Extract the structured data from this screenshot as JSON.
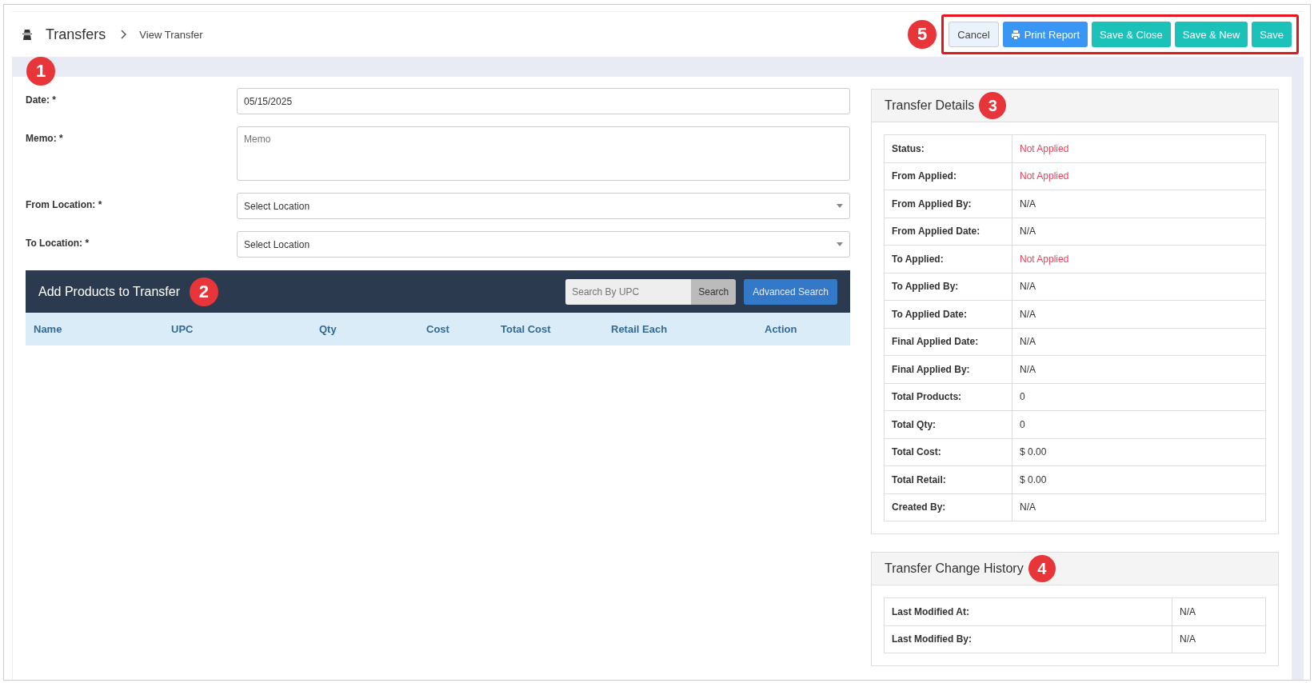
{
  "header": {
    "title": "Transfers",
    "breadcrumb": "View Transfer",
    "callout": "5",
    "buttons": [
      {
        "label": "Cancel",
        "kind": "cancel"
      },
      {
        "label": "Print Report",
        "kind": "print"
      },
      {
        "label": "Save & Close",
        "kind": "save"
      },
      {
        "label": "Save & New",
        "kind": "save"
      },
      {
        "label": "Save",
        "kind": "save"
      }
    ]
  },
  "form": {
    "callout": "1",
    "fields": [
      {
        "label": "Date: *",
        "kind": "text",
        "value": "05/15/2025"
      },
      {
        "label": "Memo: *",
        "kind": "textarea",
        "placeholder": "Memo"
      },
      {
        "label": "From Location: *",
        "kind": "select",
        "value": "Select Location"
      },
      {
        "label": "To Location: *",
        "kind": "select",
        "value": "Select Location"
      }
    ]
  },
  "products": {
    "title": "Add Products to Transfer",
    "callout": "2",
    "search": {
      "placeholder": "Search By UPC",
      "button": "Search"
    },
    "advanced_button": "Advanced Search",
    "columns": [
      "Name",
      "UPC",
      "Qty",
      "Cost",
      "Total Cost",
      "Retail Each",
      "Action"
    ]
  },
  "details": {
    "title": "Transfer Details",
    "callout": "3",
    "rows": [
      {
        "label": "Status:",
        "value": "Not Applied",
        "alert": true
      },
      {
        "label": "From Applied:",
        "value": "Not Applied",
        "alert": true
      },
      {
        "label": "From Applied By:",
        "value": "N/A",
        "alert": false
      },
      {
        "label": "From Applied Date:",
        "value": "N/A",
        "alert": false
      },
      {
        "label": "To Applied:",
        "value": "Not Applied",
        "alert": true
      },
      {
        "label": "To Applied By:",
        "value": "N/A",
        "alert": false
      },
      {
        "label": "To Applied Date:",
        "value": "N/A",
        "alert": false
      },
      {
        "label": "Final Applied Date:",
        "value": "N/A",
        "alert": false
      },
      {
        "label": "Final Applied By:",
        "value": "N/A",
        "alert": false
      },
      {
        "label": "Total Products:",
        "value": "0",
        "alert": false
      },
      {
        "label": "Total Qty:",
        "value": "0",
        "alert": false
      },
      {
        "label": "Total Cost:",
        "value": "$ 0.00",
        "alert": false
      },
      {
        "label": "Total Retail:",
        "value": "$ 0.00",
        "alert": false
      },
      {
        "label": "Created By:",
        "value": "N/A",
        "alert": false
      }
    ]
  },
  "history": {
    "title": "Transfer Change History",
    "callout": "4",
    "rows": [
      {
        "label": "Last Modified At:",
        "value": "N/A"
      },
      {
        "label": "Last Modified By:",
        "value": "N/A"
      }
    ]
  }
}
